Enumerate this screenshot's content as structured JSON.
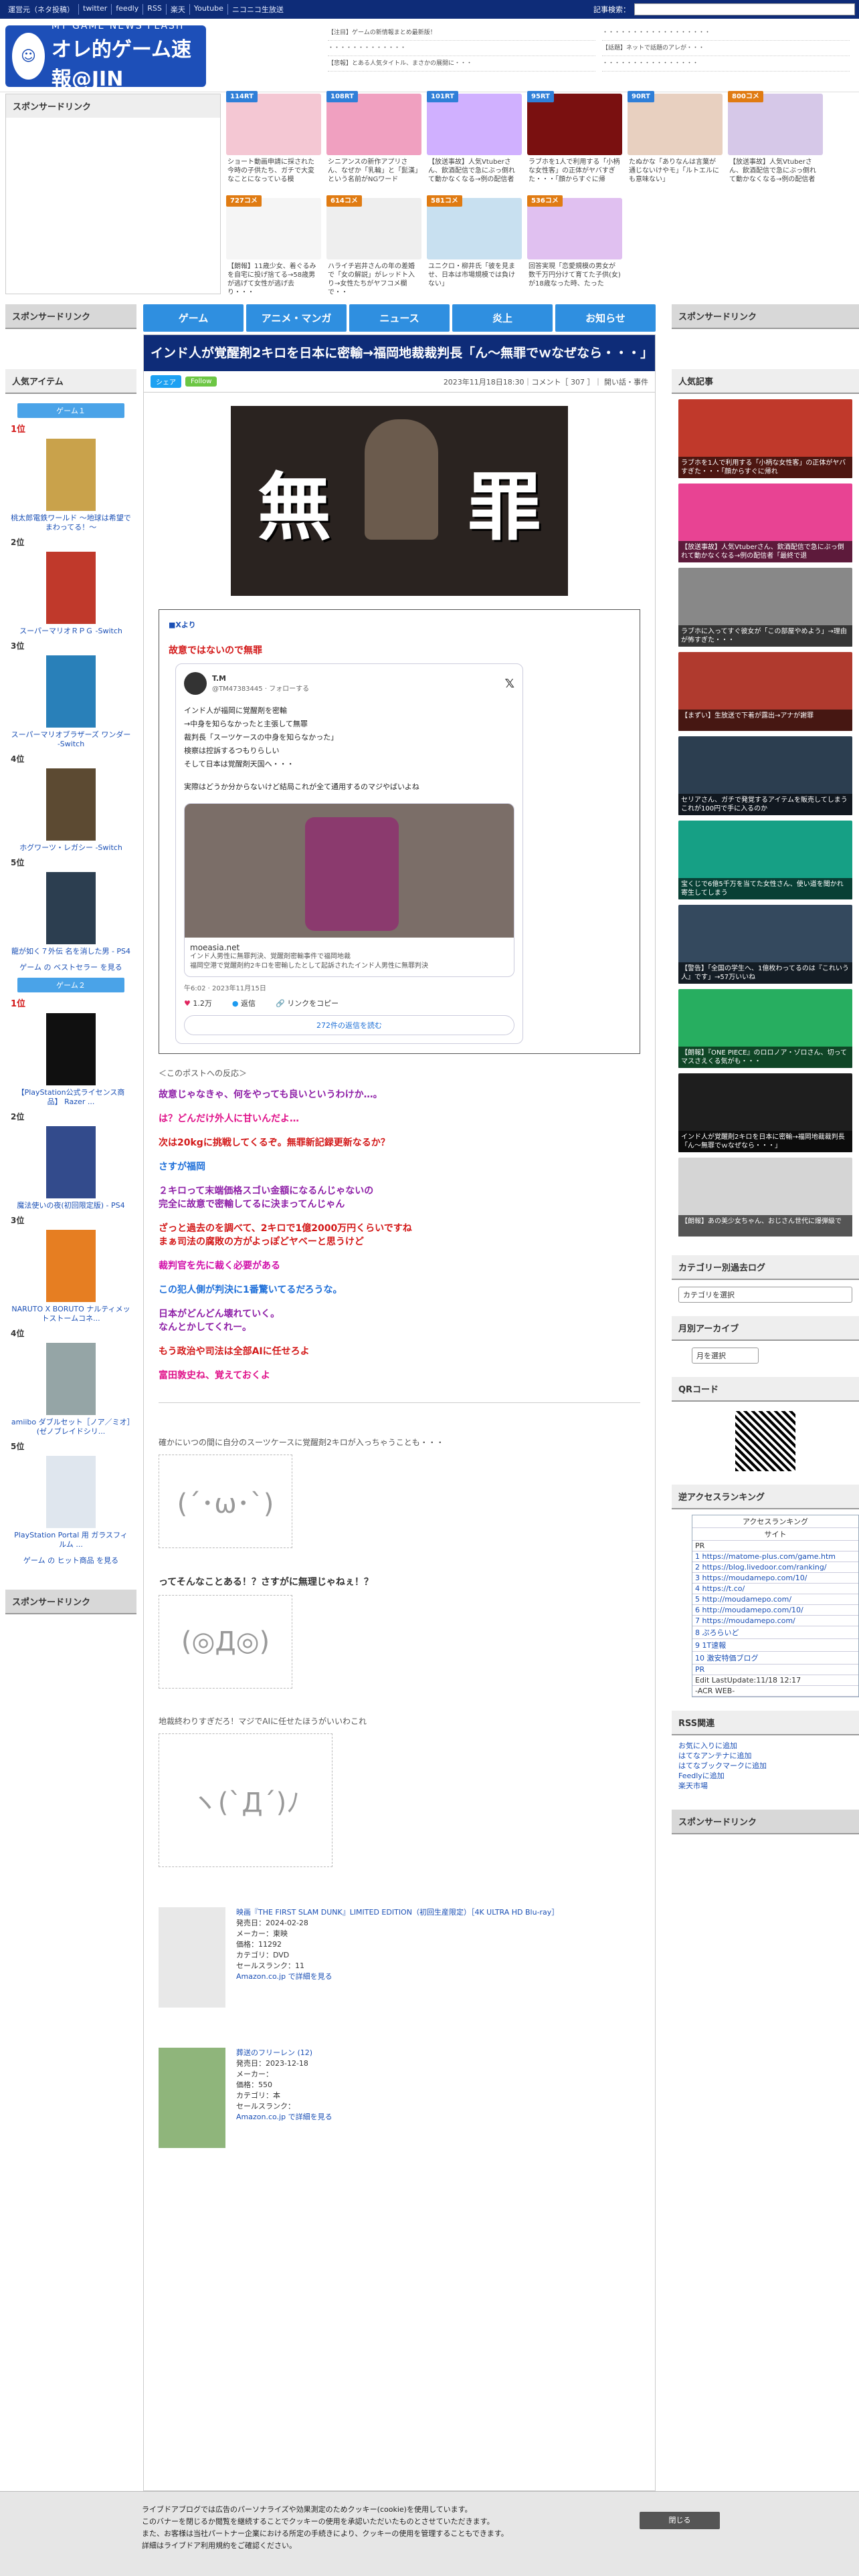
{
  "topbar": {
    "links": [
      "運営元（ネタ投稿）",
      "twitter",
      "feedly",
      "RSS",
      "楽天",
      "Youtube",
      "ニコニコ生放送"
    ],
    "search_label": "記事検索："
  },
  "site": {
    "logo_small": "MY GAME NEWS FLASH",
    "logo_title": "オレ的ゲーム速報@JIN"
  },
  "header_news": [
    [
      "【注目】ゲームの新情報まとめ最新版！",
      "・・・・・・・・・・・・・",
      "【悲報】とある人気タイトル、まさかの展開に・・・"
    ],
    [
      "・・・・・・・・・・・・・・・・・・",
      "【話題】ネットで話題のアレが・・・",
      "・・・・・・・・・・・・・・・・"
    ]
  ],
  "thumbs": [
    {
      "badge": "114RT",
      "color": "#2f7fd8",
      "cap": "ショート動画申請に採された今時の子供たち、ガチで大変なことになっている模"
    },
    {
      "badge": "108RT",
      "color": "#2f7fd8",
      "cap": "シニアンスの新作アプリさん、なぜか「乳輪」と「髭漢」という名前がNGワード"
    },
    {
      "badge": "101RT",
      "color": "#2f7fd8",
      "cap": "【放送事故】人気Vtuberさん、飲酒配信で急にぶっ倒れて動かなくなる→例の配信者"
    },
    {
      "badge": "95RT",
      "color": "#2f7fd8",
      "cap": "ラブホを1人で利用する「小柄な女性客」の正体がヤバすぎた・・・「顔からすぐに帰"
    },
    {
      "badge": "90RT",
      "color": "#2f7fd8",
      "cap": "たぬかな「ありなんは言葉が通じないけやモ」「ルトエルにも意味ない」"
    },
    {
      "badge": "800コメ",
      "color": "#e07b12",
      "cap": "【放送事故】人気Vtuberさん、飲酒配信で急にぶっ倒れて動かなくなる→例の配信者"
    },
    {
      "badge": "727コメ",
      "color": "#e07b12",
      "cap": "【朗報】11歳少女、着ぐるみを自宅に投げ捨てる→58歳男が逃げて女性が逃げ去り・・・"
    },
    {
      "badge": "614コメ",
      "color": "#e07b12",
      "cap": "ハライチ岩井さんの年の差婚で「女の解説」がレッドト入り→女性たちがヤフコメ欄で・・"
    },
    {
      "badge": "581コメ",
      "color": "#e07b12",
      "cap": "ユニクロ・柳井氏「彼を見ませ、日本は市場規模では負けない」"
    },
    {
      "badge": "536コメ",
      "color": "#e07b12",
      "cap": "回答実現「恋愛規模の男女が数千万円分けて育てた子供(女)が18歳なった時、たった"
    }
  ],
  "nav": [
    "ゲーム",
    "アニメ・マンガ",
    "ニュース",
    "炎上",
    "お知らせ"
  ],
  "left": {
    "sponsor": "スポンサードリンク",
    "popular": "人気アイテム",
    "game1": "ゲーム１",
    "game2": "ゲーム２",
    "items1": [
      {
        "rank": "1位",
        "name": "桃太郎電鉄ワールド ～地球は希望でまわってる！～",
        "color": "#c9a24b"
      },
      {
        "rank": "2位",
        "name": "スーパーマリオＲＰＧ -Switch",
        "color": "#c0392b"
      },
      {
        "rank": "3位",
        "name": "スーパーマリオブラザーズ ワンダー -Switch",
        "color": "#2980b9"
      },
      {
        "rank": "4位",
        "name": "ホグワーツ・レガシー -Switch",
        "color": "#5c4a32"
      },
      {
        "rank": "5位",
        "name": "龍が如く７外伝 名を消した男 - PS4",
        "color": "#2c3e50"
      }
    ],
    "bestseller1": "ゲーム の ベストセラー を見る",
    "items2": [
      {
        "rank": "1位",
        "name": "【PlayStation公式ライセンス商品】 Razer ...",
        "color": "#101010"
      },
      {
        "rank": "2位",
        "name": "魔法使いの夜(初回限定版) - PS4",
        "color": "#334b8c"
      },
      {
        "rank": "3位",
        "name": "NARUTO X BORUTO ナルティメットストームコネ...",
        "color": "#e67e22"
      },
      {
        "rank": "4位",
        "name": "amiibo ダブルセット［ノア／ミオ］(ゼノブレイドシリ...",
        "color": "#95a5a6"
      },
      {
        "rank": "5位",
        "name": "PlayStation Portal 用 ガラスフィルム ...",
        "color": "#dfe6ee"
      }
    ],
    "hit2": "ゲーム の ヒット商品 を見る",
    "sponsor2": "スポンサードリンク"
  },
  "article": {
    "title": "インド人が覚醒剤2キロを日本に密輸→福岡地裁裁判長「ん〜無罪でｗなぜなら・・・」",
    "share": "シェア",
    "follow": "Follow",
    "meta": "2023年11月18日18:30｜コメント［ 307 ］｜ 開い話・事件",
    "hero_left": "無",
    "hero_right": "罪",
    "source": "■Xより",
    "subhead": "故意ではないので無罪",
    "tweet": {
      "name": "T.M",
      "handle": "@TM47383445 · フォローする",
      "text": [
        "インド人が福岡に覚醒剤を密輸",
        "→中身を知らなかったと主張して無罪",
        "裁判長「スーツケースの中身を知らなかった」",
        "検察は控訴するつもりらしい",
        "そして日本は覚醒剤天国へ・・・",
        "",
        "実際はどうか分からないけど結局これが全て通用するのマジやばいよね"
      ],
      "card_domain": "moeasia.net",
      "card_title": "インド人男性に無罪判決、覚醒剤密輸事件で福岡地裁",
      "card_desc": "福岡空港で覚醒剤約2キロを密輸したとして起訴されたインド人男性に無罪判決",
      "time": "午6:02 · 2023年11月15日",
      "likes": "1.2万",
      "reply": "返信",
      "copy": "リンクをコピー",
      "more": "272件の返信を読む"
    },
    "lead": "＜このポストへの反応＞",
    "comments": [
      {
        "t": "故意じゃなきゃ、何をやっても良いというわけか…。",
        "c": "c-purple"
      },
      {
        "t": "は？どんだけ外人に甘いんだよ…",
        "c": "c-pink"
      },
      {
        "t": "次は20kgに挑戦してくるぞ。無罪新記録更新なるか？",
        "c": "c-red"
      },
      {
        "t": "さすが福岡",
        "c": "c-blue"
      },
      {
        "t": "２キロって末端価格スゴい金額になるんじゃないの\n完全に故意で密輸してるに決まってんじゃん",
        "c": "c-purple"
      },
      {
        "t": "ざっと過去のを調べて、2キロで1億2000万円くらいですね\nまぁ司法の腐敗の方がよっぽどヤベーと思うけど",
        "c": "c-red"
      },
      {
        "t": "裁判官を先に裁く必要がある",
        "c": "c-magenta"
      },
      {
        "t": "この犯人側が判決に1番驚いてるだろうな。",
        "c": "c-blue"
      },
      {
        "t": "日本がどんどん壊れていく。\nなんとかしてくれー。",
        "c": "c-purple"
      },
      {
        "t": "もう政治や司法は全部AIに任せろよ",
        "c": "c-red"
      },
      {
        "t": "富田敦史ね、覚えておくよ",
        "c": "c-pink"
      }
    ],
    "aa1": "確かにいつの間に自分のスーツケースに覚醒剤2キロが入っちゃうことも・・・",
    "aa2": "ってそんなことある！？さすがに無理じゃねぇ！？",
    "aa3": "地裁終わりすぎだろ！マジでAIに任せたほうがいいわこれ",
    "products": [
      {
        "title": "映画『THE FIRST SLAM DUNK』LIMITED EDITION（初回生産限定）［4K ULTRA HD Blu-ray］",
        "lines": [
          "発売日：2024-02-28",
          "メーカー：東映",
          "価格：11292",
          "カテゴリ：DVD",
          "セールスランク：11"
        ],
        "link": "Amazon.co.jp で詳細を見る",
        "color": "#e8e8e8"
      },
      {
        "title": "葬送のフリーレン (12)",
        "lines": [
          "発売日：2023-12-18",
          "メーカー：",
          "価格：550",
          "カテゴリ：本",
          "セールスランク："
        ],
        "link": "Amazon.co.jp で詳細を見る",
        "color": "#8fb57b"
      }
    ]
  },
  "right": {
    "sponsor": "スポンサードリンク",
    "recent": "人気記事",
    "thumbs": [
      {
        "cap": "ラブホを1人で利用する「小柄な女性客」の正体がヤバすぎた・・・「顔からすぐに帰れ",
        "color": "#c0392b"
      },
      {
        "cap": "【放送事故】人気Vtuberさん、飲酒配信で急にぶっ倒れて動かなくなる→例の配信者「最終で退",
        "color": "#e84393"
      },
      {
        "cap": "ラブホに入ってすぐ彼女が「この部屋やめよう」→理由が怖すぎた・・・",
        "color": "#888"
      },
      {
        "cap": "【まずい】生放送で下着が露出→アナが謝罪",
        "color": "#b03a2e"
      },
      {
        "cap": "セリアさん、ガチで発覚するアイテムを販売してしまう　これが100円で手に入るのか",
        "color": "#2c3e50"
      },
      {
        "cap": "宝くじで6億5千万を当てた女性さん、使い道を聞かれ寄生してしまう",
        "color": "#16a085"
      },
      {
        "cap": "【警告】「全国の学生へ、1億枚わってるのは『これいう人』です」→57万いいね",
        "color": "#34495e"
      },
      {
        "cap": "【朗報】『ONE PIECE』のロロノア・ゾロさん、切ってマスさえくる気がも・・・",
        "color": "#27ae60"
      },
      {
        "cap": "インド人が覚醒剤2キロを日本に密輸→福岡地裁裁判長「ん〜無罪でｗなぜなら・・・」",
        "color": "#1e1e1e"
      },
      {
        "cap": "【朗報】あの美少女ちゃん、おじさん世代に爆弾級で",
        "color": "#d5d5d5"
      }
    ],
    "category": "カテゴリー別過去ログ",
    "category_select": "カテゴリを選択",
    "archive": "月別アーカイブ",
    "archive_select": "月を選択",
    "qr": "QRコード",
    "acr_head": "逆アクセスランキング",
    "acr": [
      "アクセスランキング",
      "サイト",
      "PR",
      "1 https://matome-plus.com/game.htm",
      "2 https://blog.livedoor.com/ranking/",
      "3 https://moudamepo.com/10/",
      "4 https://t.co/",
      "5 http://moudamepo.com/",
      "6 http://moudamepo.com/10/",
      "7 https://moudamepo.com/",
      "8 ぷろらいど",
      "9 1T速報",
      "10 激安特価ブログ",
      "PR",
      "Edit LastUpdate:11/18 12:17",
      "-ACR WEB-"
    ],
    "rss": "RSS関連",
    "rss_links": [
      "お気に入りに追加",
      "はてなアンテナに追加",
      "はてなブックマークに追加",
      "Feedlyに追加",
      "楽天市場"
    ],
    "sponsor2": "スポンサードリンク"
  },
  "cookie": {
    "lines": [
      "ライブドアブログでは広告のパーソナライズや効果測定のためクッキー(cookie)を使用しています。",
      "このバナーを閉じるか閲覧を継続することでクッキーの使用を承認いただいたものとさせていただきます。",
      "また、お客様は当社パートナー企業における所定の手続きにより、クッキーの使用を管理することもできます。",
      "詳細はライブドア利用規約をご確認ください。"
    ],
    "close": "閉じる"
  }
}
